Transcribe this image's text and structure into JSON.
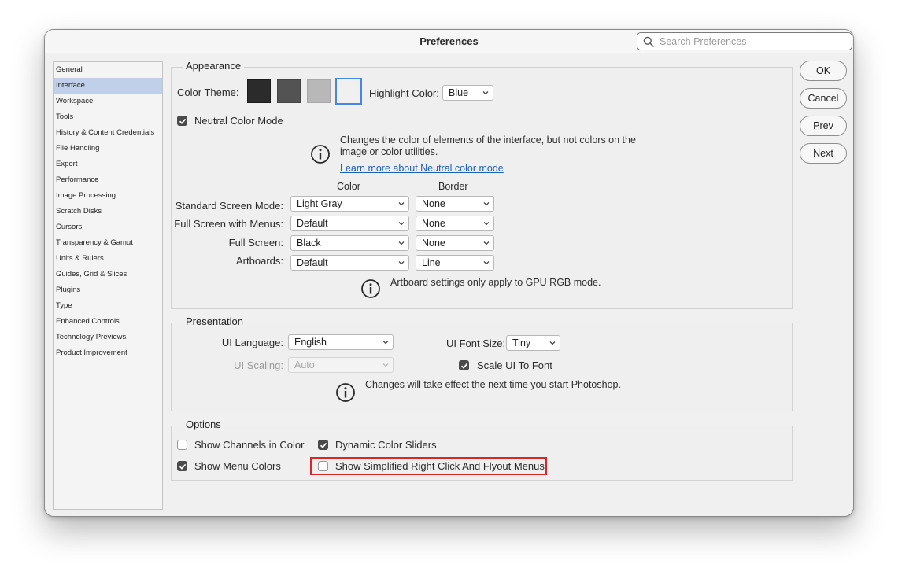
{
  "window": {
    "title": "Preferences"
  },
  "search": {
    "placeholder": "Search Preferences",
    "icon": "search-icon"
  },
  "sidebar": {
    "items": [
      {
        "label": "General"
      },
      {
        "label": "Interface",
        "selected": true
      },
      {
        "label": "Workspace"
      },
      {
        "label": "Tools"
      },
      {
        "label": "History & Content Credentials"
      },
      {
        "label": "File Handling"
      },
      {
        "label": "Export"
      },
      {
        "label": "Performance"
      },
      {
        "label": "Image Processing"
      },
      {
        "label": "Scratch Disks"
      },
      {
        "label": "Cursors"
      },
      {
        "label": "Transparency & Gamut"
      },
      {
        "label": "Units & Rulers"
      },
      {
        "label": "Guides, Grid & Slices"
      },
      {
        "label": "Plugins"
      },
      {
        "label": "Type"
      },
      {
        "label": "Enhanced Controls"
      },
      {
        "label": "Technology Previews"
      },
      {
        "label": "Product Improvement"
      }
    ]
  },
  "appearance": {
    "title": "Appearance",
    "color_theme_label": "Color Theme:",
    "theme_swatches": [
      {
        "color": "#2b2b2b"
      },
      {
        "color": "#535353"
      },
      {
        "color": "#b8b8b8"
      },
      {
        "color": "#f0f0f0",
        "selected": true
      }
    ],
    "highlight_label": "Highlight Color:",
    "highlight_value": "Blue",
    "neutral_label": "Neutral Color Mode",
    "neutral_checked": true,
    "neutral_note_line1": "Changes the color of elements of the interface, but not colors on the",
    "neutral_note_line2": "image or color utilities.",
    "neutral_link": "Learn more about Neutral color mode",
    "col_color": "Color",
    "col_border": "Border",
    "rows": [
      {
        "label": "Standard Screen Mode:",
        "color": "Light Gray",
        "border": "None"
      },
      {
        "label": "Full Screen with Menus:",
        "color": "Default",
        "border": "None"
      },
      {
        "label": "Full Screen:",
        "color": "Black",
        "border": "None"
      },
      {
        "label": "Artboards:",
        "color": "Default",
        "border": "Line"
      }
    ],
    "artboard_note": "Artboard settings only apply to GPU RGB mode."
  },
  "presentation": {
    "title": "Presentation",
    "ui_language_label": "UI Language:",
    "ui_language_value": "English",
    "ui_font_size_label": "UI Font Size:",
    "ui_font_size_value": "Tiny",
    "ui_scaling_label": "UI Scaling:",
    "ui_scaling_value": "Auto",
    "scale_ui_label": "Scale UI To Font",
    "scale_ui_checked": true,
    "note": "Changes will take effect the next time you start Photoshop."
  },
  "options": {
    "title": "Options",
    "show_channels_label": "Show Channels in Color",
    "show_channels_checked": false,
    "dynamic_sliders_label": "Dynamic Color Sliders",
    "dynamic_sliders_checked": true,
    "show_menu_colors_label": "Show Menu Colors",
    "show_menu_colors_checked": true,
    "simplified_menus_label": "Show Simplified Right Click And Flyout Menus",
    "simplified_menus_checked": false
  },
  "buttons": {
    "ok": "OK",
    "cancel": "Cancel",
    "prev": "Prev",
    "next": "Next"
  },
  "colors": {
    "highlight_outline": "#d9262b",
    "link": "#1b5fb5",
    "sidebar_selected": "#bfd0e8"
  }
}
